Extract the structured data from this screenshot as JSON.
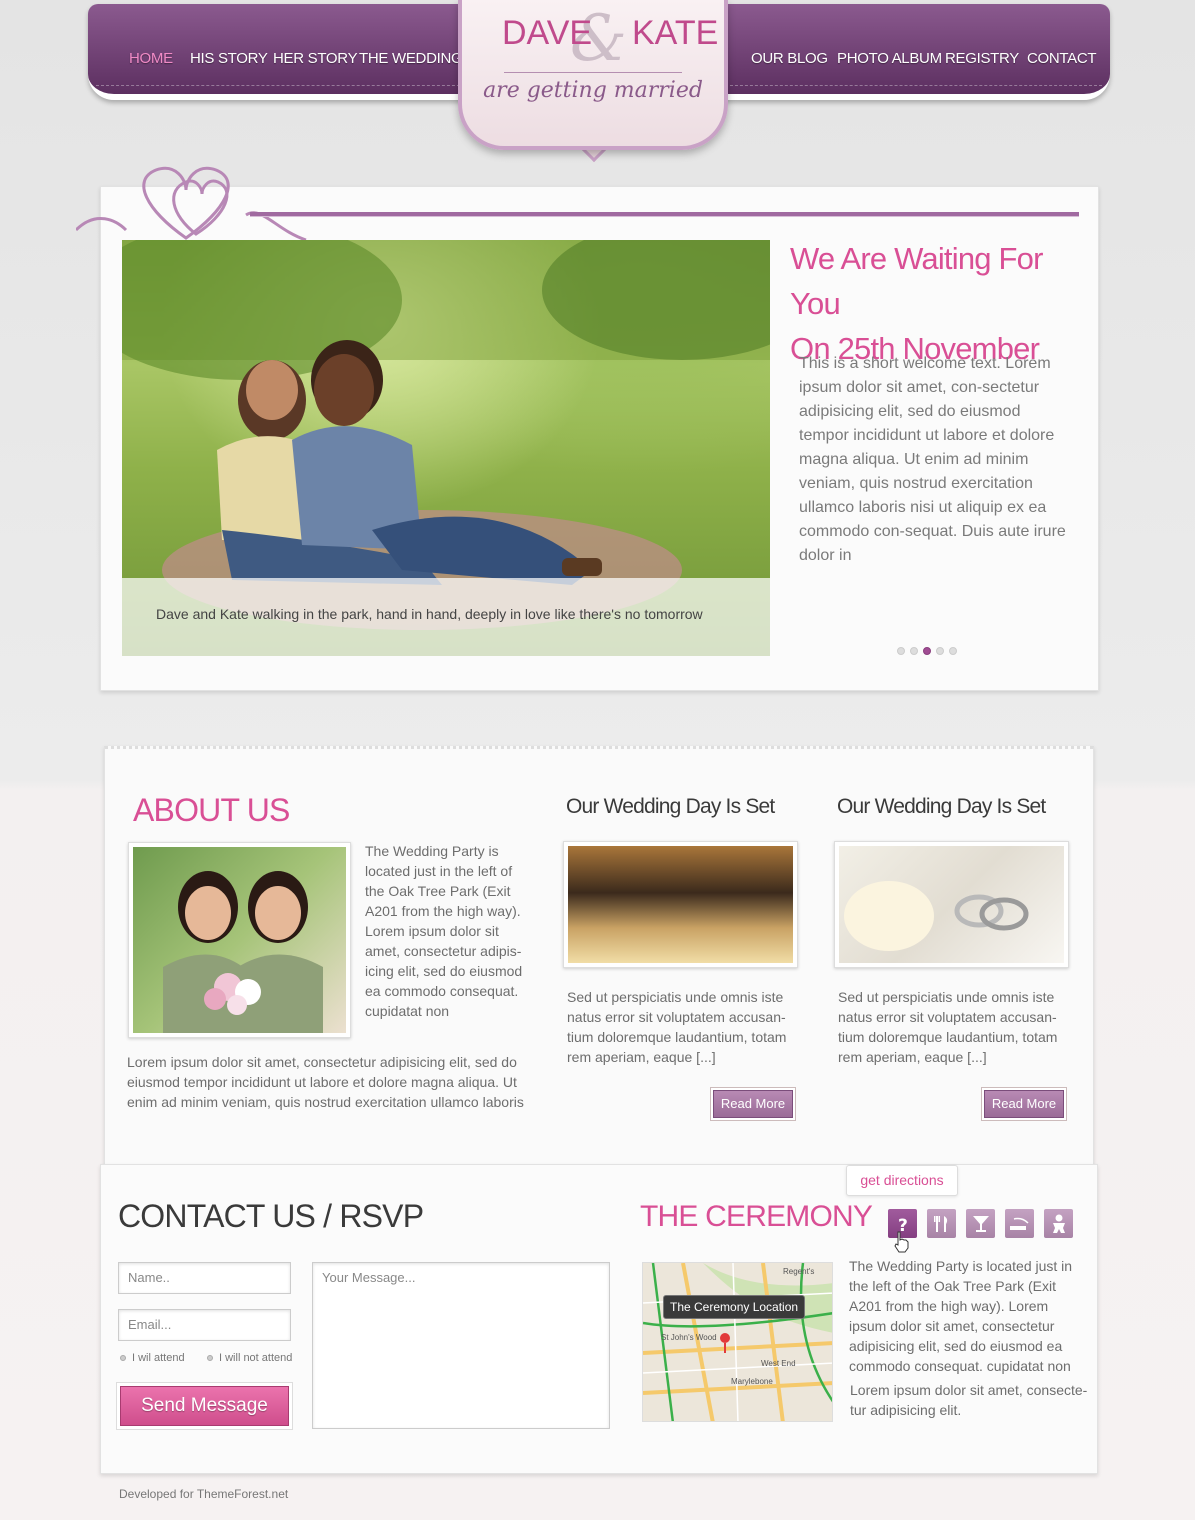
{
  "nav": {
    "left": [
      "HOME",
      "HIS STORY",
      "HER STORY",
      "THE  WEDDING"
    ],
    "right": [
      "OUR BLOG",
      "PHOTO ALBUM",
      "REGISTRY",
      "CONTACT"
    ],
    "active_index": 0
  },
  "logo": {
    "name_left": "DAVE",
    "ampersand": "&",
    "name_right": "KATE",
    "tagline": "are getting married"
  },
  "hero": {
    "title_line1": "We Are Waiting For You",
    "title_line2": "On 25th November",
    "text": "This is a short welcome text. Lorem ipsum dolor sit amet, con-sectetur adipisicing elit, sed do eiusmod tempor incididunt ut labore et dolore magna aliqua. Ut enim ad minim veniam, quis nostrud exercitation ullamco laboris nisi ut aliquip ex ea commodo con-sequat. Duis aute irure dolor in",
    "caption": "Dave and Kate walking in the park, hand in hand, deeply in love like there's no tomorrow",
    "slides_count": 5,
    "active_slide": 2
  },
  "about": {
    "heading": "ABOUT US",
    "side_text": "The Wedding Party is located just in the left of the Oak Tree Park (Exit A201 from the high way). Lorem ipsum dolor sit amet, consectetur adipis-icing elit, sed do eiusmod ea commodo consequat. cupidatat non",
    "bottom_text": "Lorem ipsum dolor sit amet, consectetur adipisicing elit, sed do eiusmod tempor incididunt ut labore et dolore magna aliqua. Ut enim ad minim veniam, quis nostrud exercitation ullamco laboris"
  },
  "posts": [
    {
      "title": "Our Wedding Day Is Set",
      "text": "Sed ut perspiciatis unde omnis iste natus error sit voluptatem accusan-tium doloremque laudantium, totam rem aperiam, eaque [...]",
      "button": "Read More"
    },
    {
      "title": "Our Wedding Day Is Set",
      "text": "Sed ut perspiciatis unde omnis iste natus error sit voluptatem accusan-tium doloremque laudantium, totam rem aperiam, eaque [...]",
      "button": "Read More"
    }
  ],
  "contact": {
    "heading": "CONTACT US / RSVP",
    "name_placeholder": "Name..",
    "email_placeholder": "Email...",
    "message_placeholder": "Your Message...",
    "attend_label": "I wil attend",
    "not_attend_label": "I will not attend",
    "send_label": "Send Message"
  },
  "ceremony": {
    "heading": "THE CEREMONY",
    "tooltip": "get directions",
    "icons": [
      "question-icon",
      "dining-icon",
      "cocktail-icon",
      "smoking-icon",
      "baby-icon"
    ],
    "map_label": "The Ceremony Location",
    "map_places": [
      "St John's Wood",
      "Regent's",
      "Marylebone",
      "West End"
    ],
    "text1": "The Wedding Party is located just in the left of the Oak Tree Park (Exit A201 from the high way). Lorem ipsum dolor sit amet, consectetur adipisicing elit, sed do eiusmod ea commodo consequat. cupidatat non",
    "text2": "Lorem ipsum dolor sit amet, consecte-tur adipisicing elit."
  },
  "footer": {
    "credit": "Developed for ThemeForest.net"
  },
  "colors": {
    "purple": "#6e3d72",
    "pink": "#d94f95",
    "button_purple": "#a87aa5"
  }
}
